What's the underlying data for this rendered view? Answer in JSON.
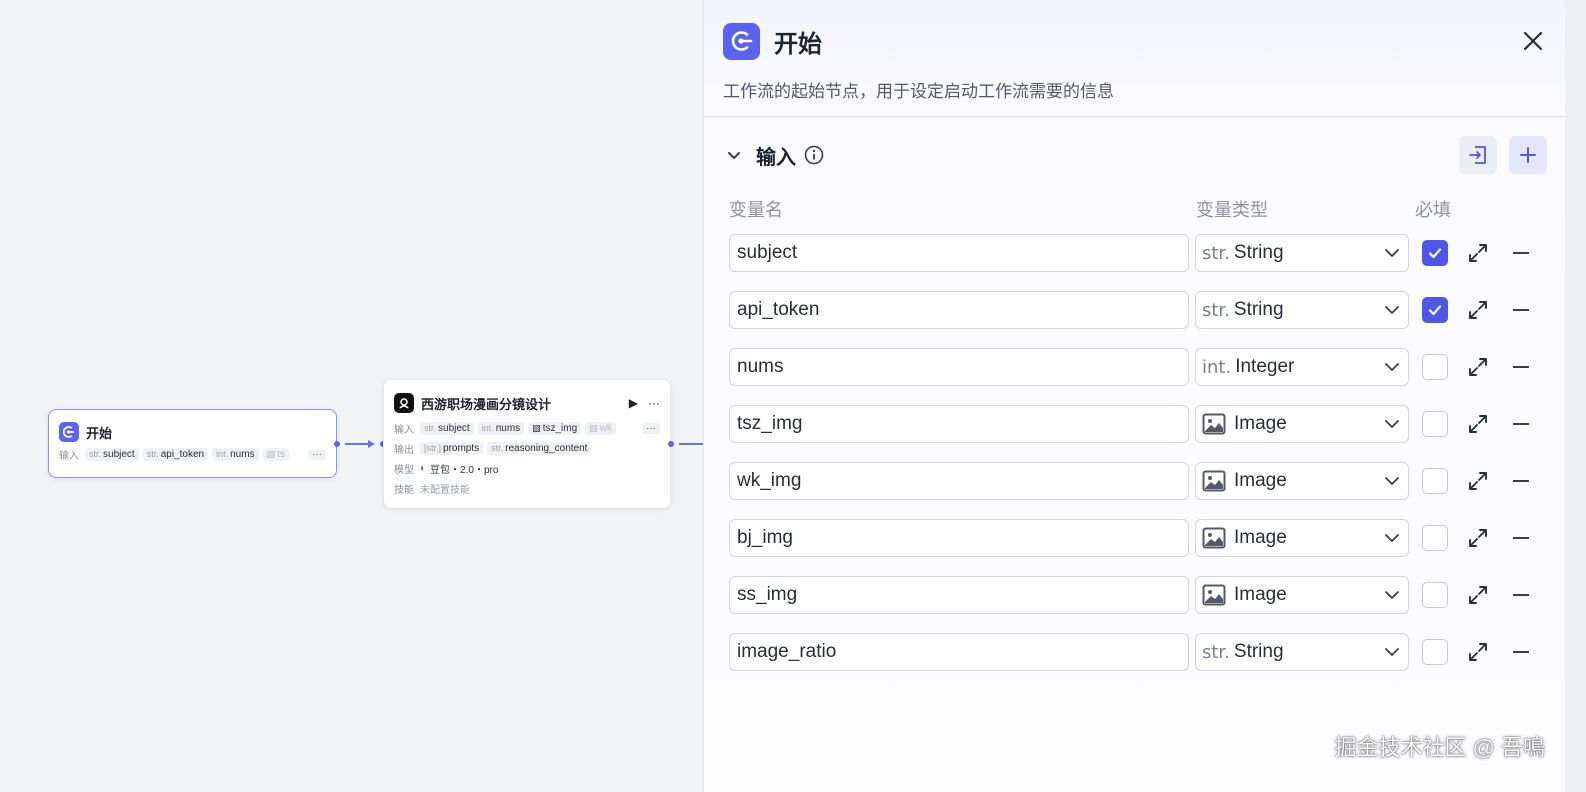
{
  "canvas": {
    "start_node": {
      "title": "开始",
      "input_label": "输入",
      "chips": [
        {
          "type": "str.",
          "name": "subject"
        },
        {
          "type": "str.",
          "name": "api_token"
        },
        {
          "type": "int.",
          "name": "nums"
        },
        {
          "type": "",
          "name": "ts"
        }
      ],
      "more": "···"
    },
    "llm_node": {
      "title": "西游职场漫画分镜设计",
      "run_icon": "▶",
      "more": "···",
      "input_label": "输入",
      "inputs": [
        {
          "type": "str.",
          "name": "subject"
        },
        {
          "type": "int.",
          "name": "nums"
        },
        {
          "type": "",
          "name": "tsz_img"
        },
        {
          "type": "",
          "name": "wk"
        }
      ],
      "output_label": "输出",
      "outputs": [
        {
          "type": "[str.]",
          "name": "prompts"
        },
        {
          "type": "str.",
          "name": "reasoning_content"
        }
      ],
      "model_label": "模型",
      "model_value": "豆包・2.0・pro",
      "skill_label": "技能",
      "skill_value": "未配置技能"
    }
  },
  "panel": {
    "title": "开始",
    "description": "工作流的起始节点，用于设定启动工作流需要的信息",
    "close_icon": "close-icon",
    "section_title": "输入",
    "columns": {
      "name": "变量名",
      "type": "变量类型",
      "required": "必填"
    },
    "variables": [
      {
        "name": "subject",
        "type_prefix": "str.",
        "type": "String",
        "is_image": false,
        "required": true
      },
      {
        "name": "api_token",
        "type_prefix": "str.",
        "type": "String",
        "is_image": false,
        "required": true
      },
      {
        "name": "nums",
        "type_prefix": "int.",
        "type": "Integer",
        "is_image": false,
        "required": false
      },
      {
        "name": "tsz_img",
        "type_prefix": "",
        "type": "Image",
        "is_image": true,
        "required": false
      },
      {
        "name": "wk_img",
        "type_prefix": "",
        "type": "Image",
        "is_image": true,
        "required": false
      },
      {
        "name": "bj_img",
        "type_prefix": "",
        "type": "Image",
        "is_image": true,
        "required": false
      },
      {
        "name": "ss_img",
        "type_prefix": "",
        "type": "Image",
        "is_image": true,
        "required": false
      },
      {
        "name": "image_ratio",
        "type_prefix": "str.",
        "type": "String",
        "is_image": false,
        "required": false
      }
    ],
    "accent_color": "#4f57e8"
  },
  "watermark": "掘金技术社区 @ 吾鳴"
}
